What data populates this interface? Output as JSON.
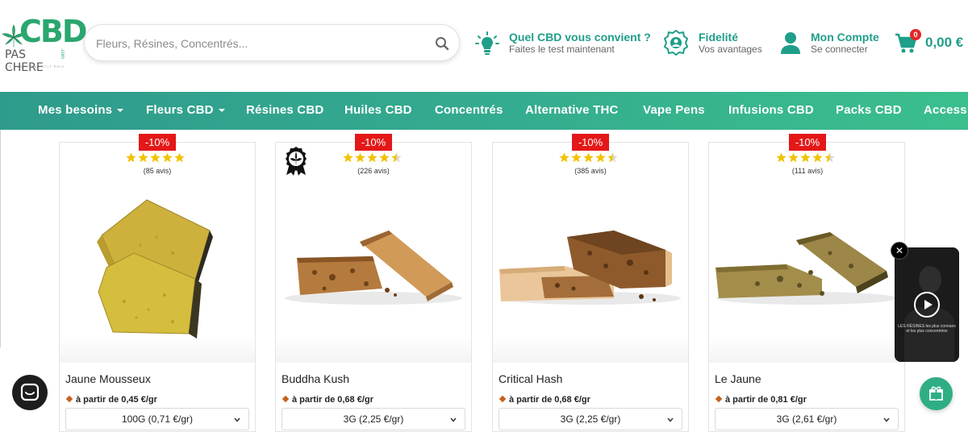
{
  "header": {
    "logo": {
      "brand": "CBD",
      "subtitle": "PAS CHERE",
      "suffix": ".com",
      "tagline": "LA QUALITE A PETIT PRIX"
    },
    "search": {
      "placeholder": "Fleurs, Résines, Concentrés..."
    },
    "quiz": {
      "title": "Quel CBD vous convient ?",
      "subtitle": "Faites le test maintenant"
    },
    "loyalty": {
      "title": "Fidelité",
      "subtitle": "Vos avantages"
    },
    "account": {
      "title": "Mon Compte",
      "subtitle": "Se connecter"
    },
    "cart": {
      "count": "0",
      "total": "0,00 €"
    }
  },
  "nav": {
    "items": [
      {
        "label": "Mes besoins",
        "dropdown": true
      },
      {
        "label": "Fleurs CBD",
        "dropdown": true
      },
      {
        "label": "Résines CBD",
        "dropdown": false
      },
      {
        "label": "Huiles CBD",
        "dropdown": false
      },
      {
        "label": "Concentrés",
        "dropdown": false
      },
      {
        "label": "Alternative THC",
        "dropdown": false
      },
      {
        "label": "Vape Pens",
        "dropdown": false
      },
      {
        "label": "Infusions CBD",
        "dropdown": false
      },
      {
        "label": "Packs CBD",
        "dropdown": false
      },
      {
        "label": "Access",
        "dropdown": false
      }
    ]
  },
  "products": [
    {
      "discount": "-10%",
      "rating": 5,
      "reviews": "(85 avis)",
      "name": "Jaune Mousseux",
      "price": "à partir de 0,45 €/gr",
      "option": "100G (0,71 €/gr)",
      "award": false
    },
    {
      "discount": "-10%",
      "rating": 4.5,
      "reviews": "(226 avis)",
      "name": "Buddha Kush",
      "price": "à partir de 0,68 €/gr",
      "option": "3G (2,25 €/gr)",
      "award": true
    },
    {
      "discount": "-10%",
      "rating": 4.5,
      "reviews": "(385 avis)",
      "name": "Critical Hash",
      "price": "à partir de 0,68 €/gr",
      "option": "3G (2,25 €/gr)",
      "award": false
    },
    {
      "discount": "-10%",
      "rating": 4.5,
      "reviews": "(111 avis)",
      "name": "Le Jaune",
      "price": "à partir de 0,81 €/gr",
      "option": "3G (2,61 €/gr)",
      "award": false
    }
  ],
  "video": {
    "close": "✕",
    "caption": "LES RÉSINES les plus connues et les plus concentrées"
  },
  "colors": {
    "accent": "#1f9e8a",
    "nav_start": "#2f9b8c",
    "nav_end": "#3bbf8d",
    "discount": "#e41818",
    "star": "#f2c200"
  },
  "icons": {
    "search": "search-icon",
    "quiz": "lightbulb-icon",
    "loyalty": "badge-icon",
    "account": "user-icon",
    "cart": "cart-icon",
    "chat": "chat-icon",
    "gift": "gift-icon",
    "award": "award-icon"
  }
}
